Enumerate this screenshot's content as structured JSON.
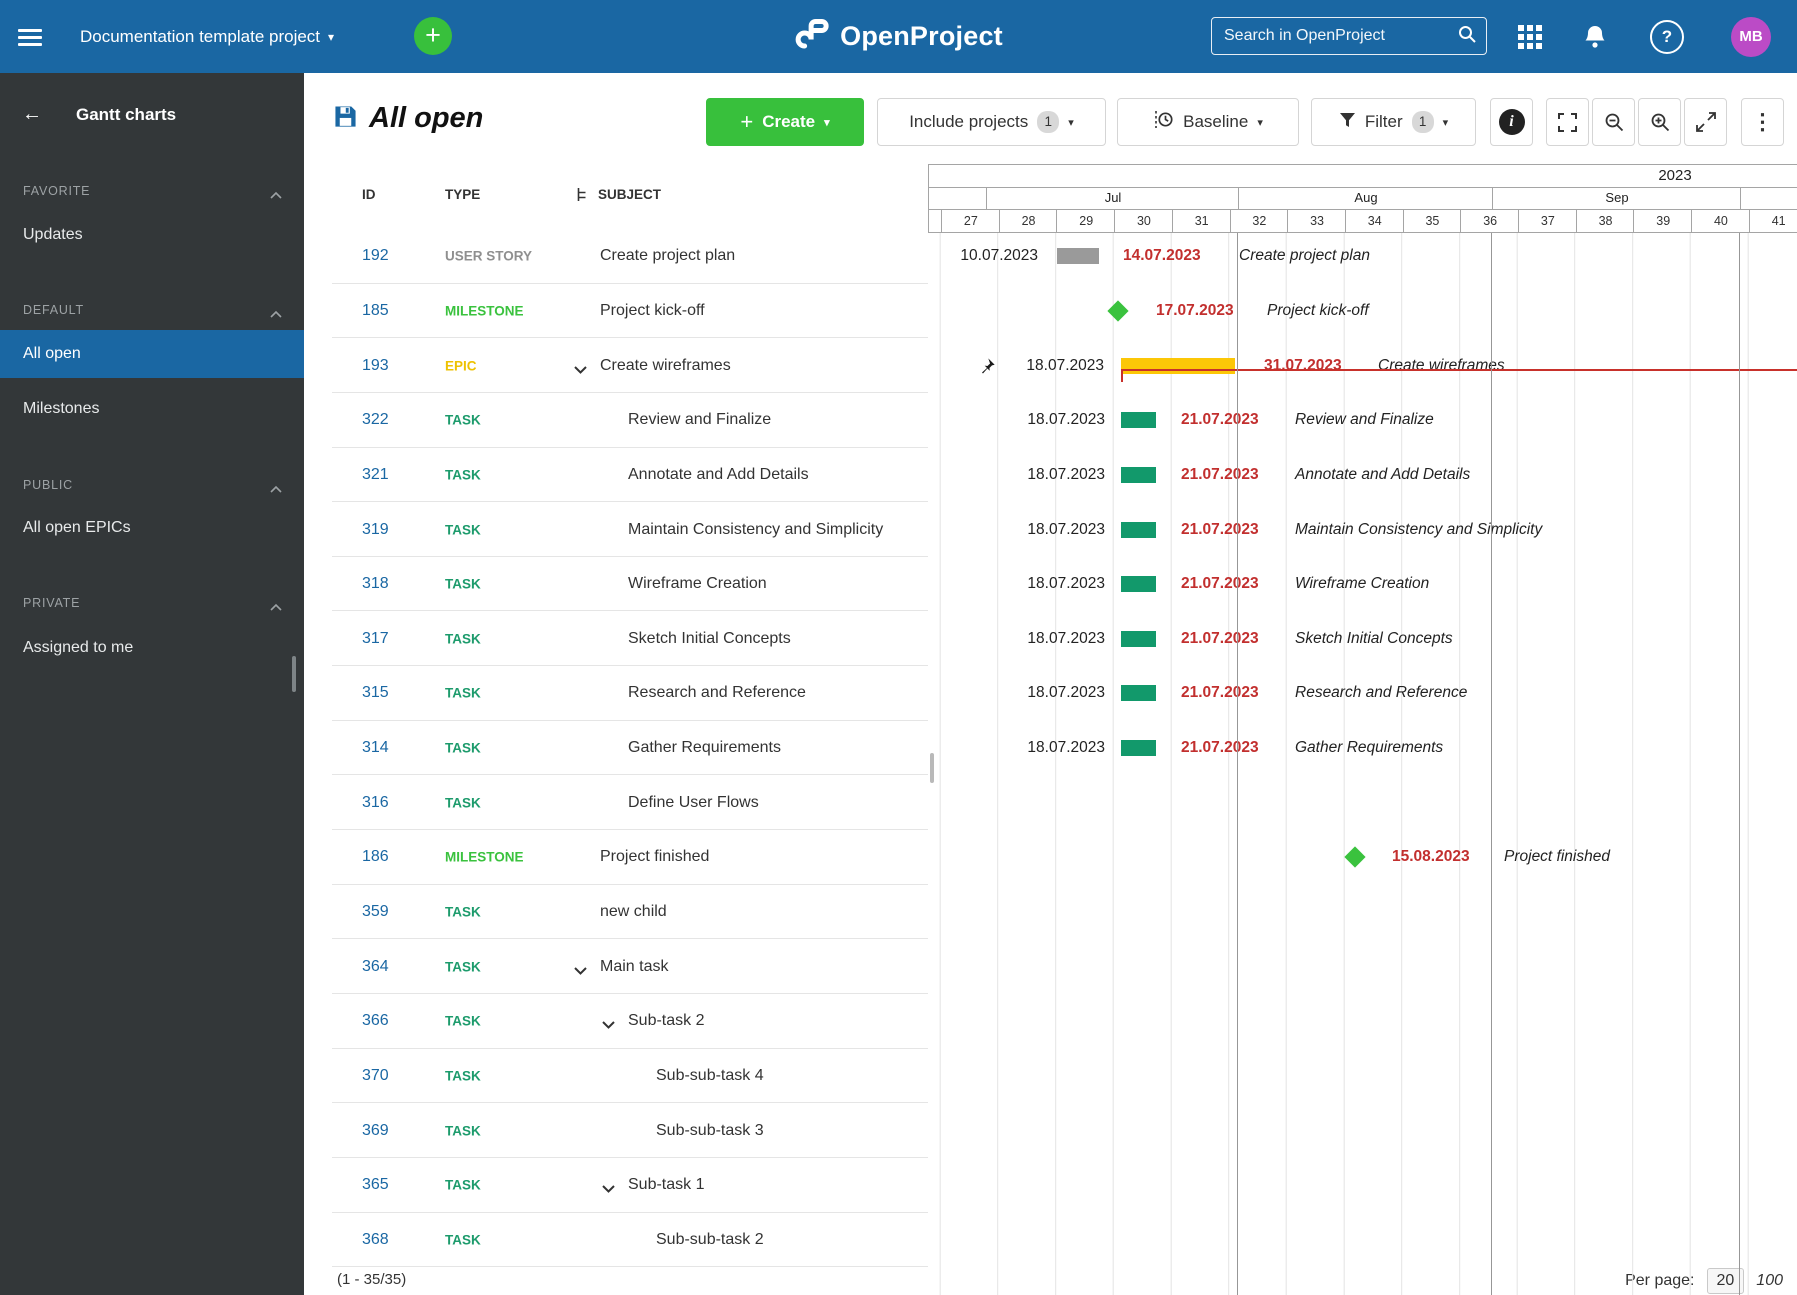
{
  "header": {
    "project_selector": "Documentation template project",
    "logo_text": "OpenProject",
    "search_placeholder": "Search in OpenProject",
    "avatar_initials": "MB",
    "help_glyph": "?",
    "plus_glyph": "+",
    "caret_glyph": "▾",
    "back_glyph": "←",
    "kebab_glyph": "⋮"
  },
  "sidebar": {
    "title": "Gantt charts",
    "sections": [
      {
        "label": "FAVORITE",
        "items": [
          {
            "label": "Updates",
            "selected": false
          }
        ]
      },
      {
        "label": "DEFAULT",
        "items": [
          {
            "label": "All open",
            "selected": true
          },
          {
            "label": "Milestones",
            "selected": false
          }
        ]
      },
      {
        "label": "PUBLIC",
        "items": [
          {
            "label": "All open EPICs",
            "selected": false
          }
        ]
      },
      {
        "label": "PRIVATE",
        "items": [
          {
            "label": "Assigned to me",
            "selected": false
          }
        ]
      }
    ]
  },
  "toolbar": {
    "title": "All open",
    "create_label": "Create",
    "include_projects_label": "Include projects",
    "include_projects_count": "1",
    "baseline_label": "Baseline",
    "filter_label": "Filter",
    "filter_count": "1"
  },
  "type_colors": {
    "TASK": "#1D9B6C",
    "MILESTONE": "#3AC23E",
    "EPIC": "#EEC202",
    "USER STORY": "#8F8F8F"
  },
  "table": {
    "columns": [
      "ID",
      "TYPE",
      "SUBJECT"
    ],
    "rows": [
      {
        "id": "192",
        "type": "USER STORY",
        "subject": "Create project plan",
        "depth": 0,
        "chevron": false,
        "gantt": {
          "kind": "bar",
          "color": "#9A9A9A",
          "start": "10.07.2023",
          "end": "14.07.2023"
        }
      },
      {
        "id": "185",
        "type": "MILESTONE",
        "subject": "Project kick-off",
        "depth": 0,
        "chevron": false,
        "gantt": {
          "kind": "milestone",
          "date": "17.07.2023"
        }
      },
      {
        "id": "193",
        "type": "EPIC",
        "subject": "Create wireframes",
        "depth": 0,
        "chevron": true,
        "gantt": {
          "kind": "epic",
          "color": "#FCC707",
          "start": "18.07.2023",
          "end": "31.07.2023",
          "pinned": true
        }
      },
      {
        "id": "322",
        "type": "TASK",
        "subject": "Review and Finalize",
        "depth": 1,
        "chevron": false,
        "gantt": {
          "kind": "bar",
          "color": "#12996B",
          "start": "18.07.2023",
          "end": "21.07.2023"
        }
      },
      {
        "id": "321",
        "type": "TASK",
        "subject": "Annotate and Add Details",
        "depth": 1,
        "chevron": false,
        "gantt": {
          "kind": "bar",
          "color": "#12996B",
          "start": "18.07.2023",
          "end": "21.07.2023"
        }
      },
      {
        "id": "319",
        "type": "TASK",
        "subject": "Maintain Consistency and Simplicity",
        "depth": 1,
        "chevron": false,
        "gantt": {
          "kind": "bar",
          "color": "#12996B",
          "start": "18.07.2023",
          "end": "21.07.2023"
        }
      },
      {
        "id": "318",
        "type": "TASK",
        "subject": "Wireframe Creation",
        "depth": 1,
        "chevron": false,
        "gantt": {
          "kind": "bar",
          "color": "#12996B",
          "start": "18.07.2023",
          "end": "21.07.2023"
        }
      },
      {
        "id": "317",
        "type": "TASK",
        "subject": "Sketch Initial Concepts",
        "depth": 1,
        "chevron": false,
        "gantt": {
          "kind": "bar",
          "color": "#12996B",
          "start": "18.07.2023",
          "end": "21.07.2023"
        }
      },
      {
        "id": "315",
        "type": "TASK",
        "subject": "Research and Reference",
        "depth": 1,
        "chevron": false,
        "gantt": {
          "kind": "bar",
          "color": "#12996B",
          "start": "18.07.2023",
          "end": "21.07.2023"
        }
      },
      {
        "id": "314",
        "type": "TASK",
        "subject": "Gather Requirements",
        "depth": 1,
        "chevron": false,
        "gantt": {
          "kind": "bar",
          "color": "#12996B",
          "start": "18.07.2023",
          "end": "21.07.2023"
        }
      },
      {
        "id": "316",
        "type": "TASK",
        "subject": "Define User Flows",
        "depth": 1,
        "chevron": false,
        "gantt": null
      },
      {
        "id": "186",
        "type": "MILESTONE",
        "subject": "Project finished",
        "depth": 0,
        "chevron": false,
        "gantt": {
          "kind": "milestone",
          "date": "15.08.2023"
        }
      },
      {
        "id": "359",
        "type": "TASK",
        "subject": "new child",
        "depth": 0,
        "chevron": false,
        "gantt": null
      },
      {
        "id": "364",
        "type": "TASK",
        "subject": "Main task",
        "depth": 0,
        "chevron": true,
        "gantt": null
      },
      {
        "id": "366",
        "type": "TASK",
        "subject": "Sub-task 2",
        "depth": 1,
        "chevron": true,
        "gantt": null
      },
      {
        "id": "370",
        "type": "TASK",
        "subject": "Sub-sub-task 4",
        "depth": 2,
        "chevron": false,
        "gantt": null
      },
      {
        "id": "369",
        "type": "TASK",
        "subject": "Sub-sub-task 3",
        "depth": 2,
        "chevron": false,
        "gantt": null
      },
      {
        "id": "365",
        "type": "TASK",
        "subject": "Sub-task 1",
        "depth": 1,
        "chevron": true,
        "gantt": null
      },
      {
        "id": "368",
        "type": "TASK",
        "subject": "Sub-sub-task 2",
        "depth": 2,
        "chevron": false,
        "gantt": null
      }
    ],
    "footer_count": "(1 - 35/35)"
  },
  "gantt": {
    "year": "2023",
    "months": [
      "Jul",
      "Aug",
      "Sep"
    ],
    "weeks": [
      "27",
      "28",
      "29",
      "30",
      "31",
      "32",
      "33",
      "34",
      "35",
      "36",
      "37",
      "38",
      "39",
      "40",
      "41"
    ]
  },
  "pagination": {
    "per_page_label": "Per page:",
    "selected": "20",
    "other": "100"
  }
}
